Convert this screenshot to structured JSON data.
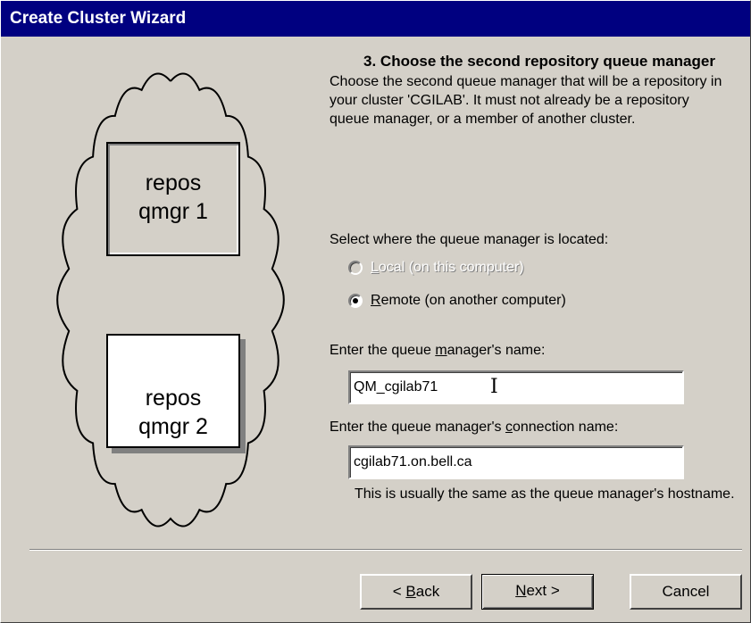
{
  "window": {
    "title": "Create Cluster Wizard"
  },
  "illustration": {
    "box1_line1": "repos",
    "box1_line2": "qmgr 1",
    "box2_line1": "repos",
    "box2_line2": "qmgr 2"
  },
  "step": {
    "title": "3. Choose the second repository queue manager",
    "description": "Choose the second queue manager that will be a repository in your cluster 'CGILAB'. It must not already be a repository queue manager, or a member of another cluster."
  },
  "location": {
    "prompt": "Select where the queue manager is located:",
    "local_prefix": "",
    "local_hotkey": "L",
    "local_rest": "ocal (on this computer)",
    "local_enabled": false,
    "remote_hotkey": "R",
    "remote_rest": "emote (on another computer)",
    "selected": "remote"
  },
  "qmgr_name": {
    "label_pre": "Enter the queue ",
    "label_hotkey": "m",
    "label_post": "anager's name:",
    "value": "QM_cgilab71"
  },
  "conn_name": {
    "label_pre": "Enter the queue manager's ",
    "label_hotkey": "c",
    "label_post": "onnection name:",
    "value": "cgilab71.on.bell.ca",
    "hint": "This is usually the same as the queue manager's hostname."
  },
  "buttons": {
    "back_pre": "< ",
    "back_hotkey": "B",
    "back_post": "ack",
    "next_hotkey": "N",
    "next_post": "ext >",
    "cancel": "Cancel"
  },
  "colors": {
    "titlebar": "#000080",
    "face": "#d4d0c8"
  }
}
